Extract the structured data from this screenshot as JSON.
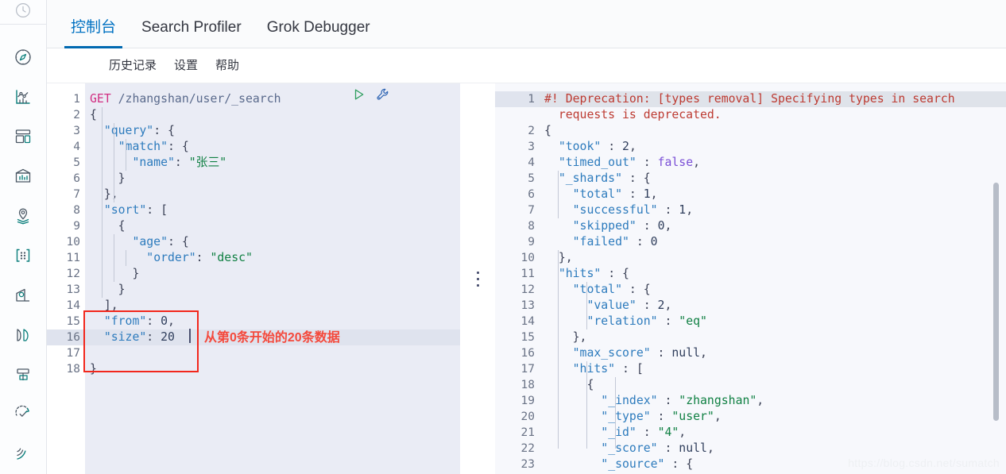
{
  "sidebar": {
    "top_icon": "clock-icon",
    "items": [
      {
        "name": "discover-icon"
      },
      {
        "name": "visualize-icon"
      },
      {
        "name": "dashboard-icon"
      },
      {
        "name": "canvas-icon"
      },
      {
        "name": "maps-icon"
      },
      {
        "name": "machine-learning-icon"
      },
      {
        "name": "infrastructure-icon"
      },
      {
        "name": "logs-icon"
      },
      {
        "name": "apm-icon"
      },
      {
        "name": "uptime-icon"
      },
      {
        "name": "siem-icon"
      }
    ]
  },
  "tabs": [
    {
      "label": "控制台",
      "active": true
    },
    {
      "label": "Search Profiler",
      "active": false
    },
    {
      "label": "Grok Debugger",
      "active": false
    }
  ],
  "subnav": [
    {
      "label": "历史记录"
    },
    {
      "label": "设置"
    },
    {
      "label": "帮助"
    }
  ],
  "toolbar": {
    "send_icon": "play-icon",
    "wrench_icon": "wrench-icon"
  },
  "request_editor": {
    "lines": [
      {
        "n": "1",
        "fold": "",
        "tokens": [
          {
            "t": "GET ",
            "c": "k-method"
          },
          {
            "t": "/zhangshan/user/_search",
            "c": "k-url"
          }
        ]
      },
      {
        "n": "2",
        "fold": "down",
        "tokens": [
          {
            "t": "{",
            "c": "k-punc"
          }
        ]
      },
      {
        "n": "3",
        "fold": "down",
        "tokens": [
          {
            "t": "  ",
            "c": ""
          },
          {
            "t": "\"query\"",
            "c": "k-key"
          },
          {
            "t": ": {",
            "c": "k-punc"
          }
        ]
      },
      {
        "n": "4",
        "fold": "down",
        "tokens": [
          {
            "t": "    ",
            "c": ""
          },
          {
            "t": "\"match\"",
            "c": "k-key"
          },
          {
            "t": ": {",
            "c": "k-punc"
          }
        ]
      },
      {
        "n": "5",
        "fold": "",
        "tokens": [
          {
            "t": "      ",
            "c": ""
          },
          {
            "t": "\"name\"",
            "c": "k-key"
          },
          {
            "t": ": ",
            "c": "k-punc"
          },
          {
            "t": "\"张三\"",
            "c": "k-str"
          }
        ]
      },
      {
        "n": "6",
        "fold": "up",
        "tokens": [
          {
            "t": "    }",
            "c": "k-punc"
          }
        ]
      },
      {
        "n": "7",
        "fold": "up",
        "tokens": [
          {
            "t": "  },",
            "c": "k-punc"
          }
        ]
      },
      {
        "n": "8",
        "fold": "down",
        "tokens": [
          {
            "t": "  ",
            "c": ""
          },
          {
            "t": "\"sort\"",
            "c": "k-key"
          },
          {
            "t": ": [",
            "c": "k-punc"
          }
        ]
      },
      {
        "n": "9",
        "fold": "down",
        "tokens": [
          {
            "t": "    {",
            "c": "k-punc"
          }
        ]
      },
      {
        "n": "10",
        "fold": "down",
        "tokens": [
          {
            "t": "      ",
            "c": ""
          },
          {
            "t": "\"age\"",
            "c": "k-key"
          },
          {
            "t": ": {",
            "c": "k-punc"
          }
        ]
      },
      {
        "n": "11",
        "fold": "",
        "tokens": [
          {
            "t": "        ",
            "c": ""
          },
          {
            "t": "\"order\"",
            "c": "k-key"
          },
          {
            "t": ": ",
            "c": "k-punc"
          },
          {
            "t": "\"desc\"",
            "c": "k-str"
          }
        ]
      },
      {
        "n": "12",
        "fold": "up",
        "tokens": [
          {
            "t": "      }",
            "c": "k-punc"
          }
        ]
      },
      {
        "n": "13",
        "fold": "up",
        "tokens": [
          {
            "t": "    }",
            "c": "k-punc"
          }
        ]
      },
      {
        "n": "14",
        "fold": "up",
        "tokens": [
          {
            "t": "  ],",
            "c": "k-punc"
          }
        ]
      },
      {
        "n": "15",
        "fold": "",
        "tokens": [
          {
            "t": "  ",
            "c": ""
          },
          {
            "t": "\"from\"",
            "c": "k-key"
          },
          {
            "t": ": ",
            "c": "k-punc"
          },
          {
            "t": "0",
            "c": "k-num"
          },
          {
            "t": ",",
            "c": "k-punc"
          }
        ]
      },
      {
        "n": "16",
        "fold": "",
        "hl": true,
        "tokens": [
          {
            "t": "  ",
            "c": ""
          },
          {
            "t": "\"size\"",
            "c": "k-key"
          },
          {
            "t": ": ",
            "c": "k-punc"
          },
          {
            "t": "20",
            "c": "k-num"
          }
        ]
      },
      {
        "n": "17",
        "fold": "",
        "tokens": [
          {
            "t": "",
            "c": ""
          }
        ]
      },
      {
        "n": "18",
        "fold": "up",
        "tokens": [
          {
            "t": "}",
            "c": "k-punc"
          }
        ]
      }
    ]
  },
  "annotation": {
    "text": "从第0条开始的20条数据",
    "color": "#f4493c",
    "box_color": "#f2271c"
  },
  "response_editor": {
    "lines": [
      {
        "n": "1",
        "fold": "",
        "hl": true,
        "tokens": [
          {
            "t": "#! Deprecation: [types removal] Specifying types in search",
            "c": "k-warn"
          }
        ]
      },
      {
        "n": "",
        "fold": "",
        "hl": false,
        "tokens": [
          {
            "t": "  requests is deprecated.",
            "c": "k-warn"
          }
        ]
      },
      {
        "n": "2",
        "fold": "down",
        "tokens": [
          {
            "t": "{",
            "c": "k-punc"
          }
        ]
      },
      {
        "n": "3",
        "fold": "",
        "tokens": [
          {
            "t": "  ",
            "c": ""
          },
          {
            "t": "\"took\"",
            "c": "k-key"
          },
          {
            "t": " : ",
            "c": "k-punc"
          },
          {
            "t": "2",
            "c": "k-num"
          },
          {
            "t": ",",
            "c": "k-punc"
          }
        ]
      },
      {
        "n": "4",
        "fold": "",
        "tokens": [
          {
            "t": "  ",
            "c": ""
          },
          {
            "t": "\"timed_out\"",
            "c": "k-key"
          },
          {
            "t": " : ",
            "c": "k-punc"
          },
          {
            "t": "false",
            "c": "k-bool"
          },
          {
            "t": ",",
            "c": "k-punc"
          }
        ]
      },
      {
        "n": "5",
        "fold": "down",
        "tokens": [
          {
            "t": "  ",
            "c": ""
          },
          {
            "t": "\"_shards\"",
            "c": "k-key"
          },
          {
            "t": " : {",
            "c": "k-punc"
          }
        ]
      },
      {
        "n": "6",
        "fold": "",
        "tokens": [
          {
            "t": "    ",
            "c": ""
          },
          {
            "t": "\"total\"",
            "c": "k-key"
          },
          {
            "t": " : ",
            "c": "k-punc"
          },
          {
            "t": "1",
            "c": "k-num"
          },
          {
            "t": ",",
            "c": "k-punc"
          }
        ]
      },
      {
        "n": "7",
        "fold": "",
        "tokens": [
          {
            "t": "    ",
            "c": ""
          },
          {
            "t": "\"successful\"",
            "c": "k-key"
          },
          {
            "t": " : ",
            "c": "k-punc"
          },
          {
            "t": "1",
            "c": "k-num"
          },
          {
            "t": ",",
            "c": "k-punc"
          }
        ]
      },
      {
        "n": "8",
        "fold": "",
        "tokens": [
          {
            "t": "    ",
            "c": ""
          },
          {
            "t": "\"skipped\"",
            "c": "k-key"
          },
          {
            "t": " : ",
            "c": "k-punc"
          },
          {
            "t": "0",
            "c": "k-num"
          },
          {
            "t": ",",
            "c": "k-punc"
          }
        ]
      },
      {
        "n": "9",
        "fold": "",
        "tokens": [
          {
            "t": "    ",
            "c": ""
          },
          {
            "t": "\"failed\"",
            "c": "k-key"
          },
          {
            "t": " : ",
            "c": "k-punc"
          },
          {
            "t": "0",
            "c": "k-num"
          }
        ]
      },
      {
        "n": "10",
        "fold": "up",
        "tokens": [
          {
            "t": "  },",
            "c": "k-punc"
          }
        ]
      },
      {
        "n": "11",
        "fold": "down",
        "tokens": [
          {
            "t": "  ",
            "c": ""
          },
          {
            "t": "\"hits\"",
            "c": "k-key"
          },
          {
            "t": " : {",
            "c": "k-punc"
          }
        ]
      },
      {
        "n": "12",
        "fold": "down",
        "tokens": [
          {
            "t": "    ",
            "c": ""
          },
          {
            "t": "\"total\"",
            "c": "k-key"
          },
          {
            "t": " : {",
            "c": "k-punc"
          }
        ]
      },
      {
        "n": "13",
        "fold": "",
        "tokens": [
          {
            "t": "      ",
            "c": ""
          },
          {
            "t": "\"value\"",
            "c": "k-key"
          },
          {
            "t": " : ",
            "c": "k-punc"
          },
          {
            "t": "2",
            "c": "k-num"
          },
          {
            "t": ",",
            "c": "k-punc"
          }
        ]
      },
      {
        "n": "14",
        "fold": "",
        "tokens": [
          {
            "t": "      ",
            "c": ""
          },
          {
            "t": "\"relation\"",
            "c": "k-key"
          },
          {
            "t": " : ",
            "c": "k-punc"
          },
          {
            "t": "\"eq\"",
            "c": "k-str"
          }
        ]
      },
      {
        "n": "15",
        "fold": "up",
        "tokens": [
          {
            "t": "    },",
            "c": "k-punc"
          }
        ]
      },
      {
        "n": "16",
        "fold": "",
        "tokens": [
          {
            "t": "    ",
            "c": ""
          },
          {
            "t": "\"max_score\"",
            "c": "k-key"
          },
          {
            "t": " : ",
            "c": "k-punc"
          },
          {
            "t": "null",
            "c": "k-null"
          },
          {
            "t": ",",
            "c": "k-punc"
          }
        ]
      },
      {
        "n": "17",
        "fold": "down",
        "tokens": [
          {
            "t": "    ",
            "c": ""
          },
          {
            "t": "\"hits\"",
            "c": "k-key"
          },
          {
            "t": " : [",
            "c": "k-punc"
          }
        ]
      },
      {
        "n": "18",
        "fold": "down",
        "tokens": [
          {
            "t": "      {",
            "c": "k-punc"
          }
        ]
      },
      {
        "n": "19",
        "fold": "",
        "tokens": [
          {
            "t": "        ",
            "c": ""
          },
          {
            "t": "\"_index\"",
            "c": "k-key"
          },
          {
            "t": " : ",
            "c": "k-punc"
          },
          {
            "t": "\"zhangshan\"",
            "c": "k-str"
          },
          {
            "t": ",",
            "c": "k-punc"
          }
        ]
      },
      {
        "n": "20",
        "fold": "",
        "tokens": [
          {
            "t": "        ",
            "c": ""
          },
          {
            "t": "\"_type\"",
            "c": "k-key"
          },
          {
            "t": " : ",
            "c": "k-punc"
          },
          {
            "t": "\"user\"",
            "c": "k-str"
          },
          {
            "t": ",",
            "c": "k-punc"
          }
        ]
      },
      {
        "n": "21",
        "fold": "",
        "tokens": [
          {
            "t": "        ",
            "c": ""
          },
          {
            "t": "\"_id\"",
            "c": "k-key"
          },
          {
            "t": " : ",
            "c": "k-punc"
          },
          {
            "t": "\"4\"",
            "c": "k-str"
          },
          {
            "t": ",",
            "c": "k-punc"
          }
        ]
      },
      {
        "n": "22",
        "fold": "",
        "tokens": [
          {
            "t": "        ",
            "c": ""
          },
          {
            "t": "\"_score\"",
            "c": "k-key"
          },
          {
            "t": " : ",
            "c": "k-punc"
          },
          {
            "t": "null",
            "c": "k-null"
          },
          {
            "t": ",",
            "c": "k-punc"
          }
        ]
      },
      {
        "n": "23",
        "fold": "down",
        "tokens": [
          {
            "t": "        ",
            "c": ""
          },
          {
            "t": "\"_source\"",
            "c": "k-key"
          },
          {
            "t": " : {",
            "c": "k-punc"
          }
        ]
      }
    ]
  },
  "watermark": "https://blog.csdn.net/sumatch"
}
